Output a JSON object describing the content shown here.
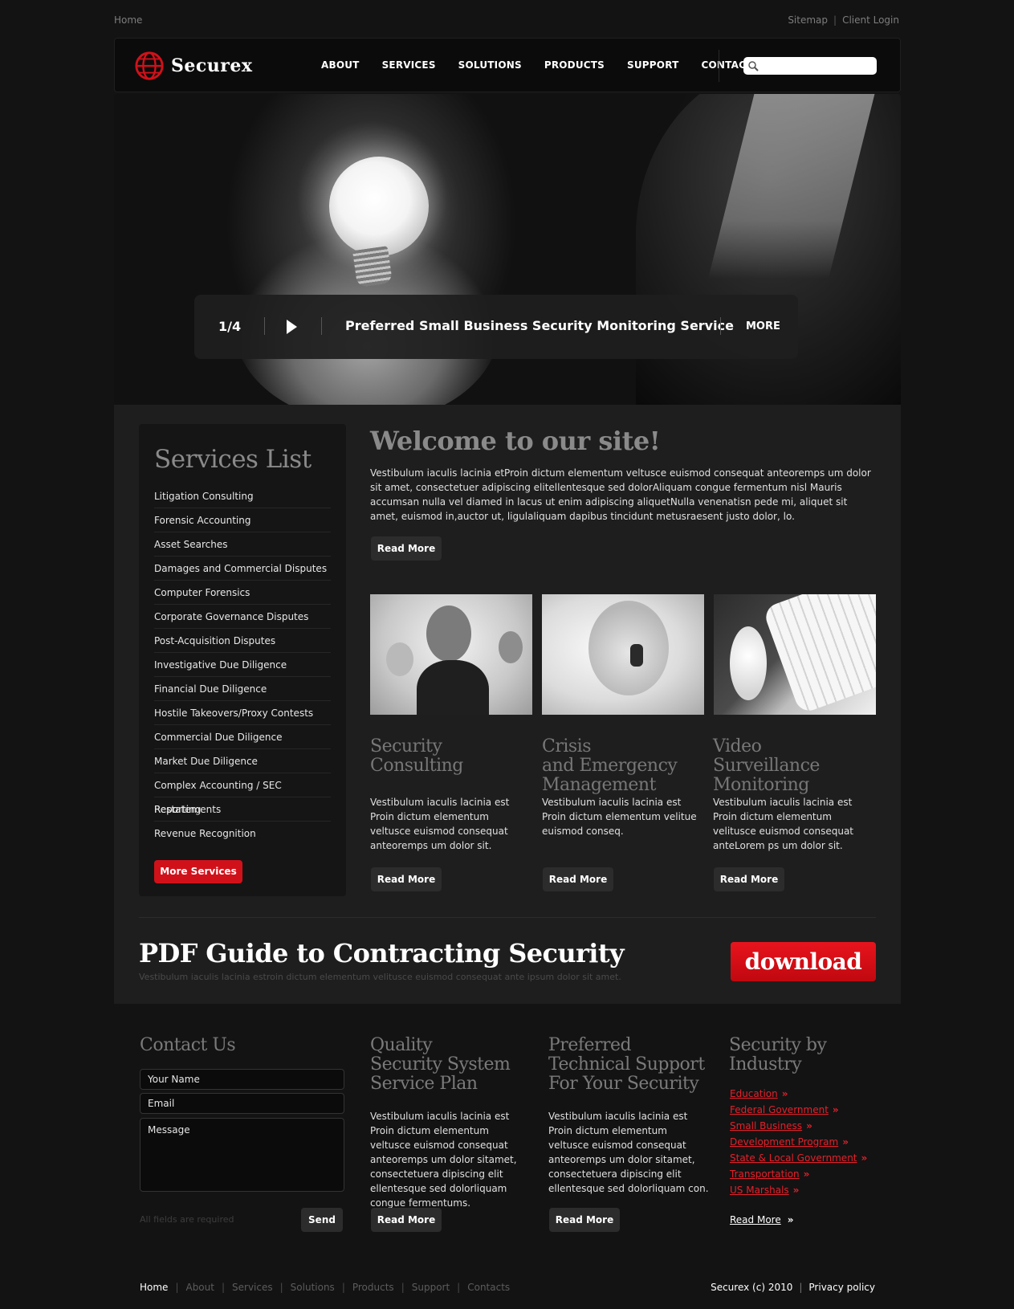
{
  "topbar": {
    "home": "Home",
    "sitemap": "Sitemap",
    "client_login": "Client Login"
  },
  "header": {
    "logo_text": "Securex",
    "nav": [
      "ABOUT",
      "SERVICES",
      "SOLUTIONS",
      "PRODUCTS",
      "SUPPORT",
      "CONTACTS"
    ],
    "search_placeholder": ""
  },
  "hero": {
    "counter": "1/4",
    "caption": "Preferred Small Business Security Monitoring Service",
    "more": "MORE"
  },
  "sidebar": {
    "title": "Services List",
    "items": [
      "Litigation Consulting",
      "Forensic Accounting",
      "Asset Searches",
      "Damages and Commercial Disputes",
      "Computer Forensics",
      "Corporate Governance Disputes",
      "Post-Acquisition Disputes",
      "Investigative Due Diligence",
      "Financial Due Diligence",
      "Hostile Takeovers/Proxy Contests",
      "Commercial Due Diligence",
      "Market Due Diligence",
      "Complex Accounting /  SEC Reporting",
      "Restatements",
      "Revenue Recognition"
    ],
    "button": "More Services"
  },
  "welcome": {
    "title": "Welcome to our site!",
    "text": "Vestibulum iaculis lacinia etProin dictum elementum veltusce euismod consequat anteoremps um dolor sit amet, consectetuer adipiscing elitellentesque sed dolorAliquam congue fermentum nisl Mauris accumsan nulla vel diamed in lacus ut enim adipiscing aliquetNulla venenatisn pede mi, aliquet sit amet, euismod in,auctor ut, ligulaliquam dapibus tincidunt metusraesent justo dolor, lo.",
    "button": "Read More"
  },
  "columns": [
    {
      "title_line1": "Security",
      "title_line2": "Consulting",
      "title_line3": "",
      "text": "Vestibulum iaculis lacinia est Proin dictum elementum veltusce euismod consequat anteoremps um dolor sit.",
      "button": "Read More"
    },
    {
      "title_line1": "Crisis",
      "title_line2": "and Emergency",
      "title_line3": "Management",
      "text": "Vestibulum iaculis lacinia est Proin dictum elementum velitue euismod conseq.",
      "button": "Read More"
    },
    {
      "title_line1": "Video Surveillance",
      "title_line2": "Monitoring",
      "title_line3": "",
      "text": "Vestibulum iaculis lacinia est Proin dictum elementum velitusce euismod consequat anteLorem ps um dolor sit.",
      "button": "Read More"
    }
  ],
  "pdf": {
    "title": "PDF Guide to Contracting Security",
    "subtitle": "Vestibulum iaculis lacinia estroin dictum elementum velitusce euismod consequat ante ipsum dolor sit amet.",
    "download": "download"
  },
  "contact": {
    "title": "Contact Us",
    "name_placeholder": "Your Name",
    "email_placeholder": "Email",
    "message_placeholder": "Message",
    "required_note": "All fields are required",
    "send": "Send"
  },
  "quality": {
    "title_line1": "Quality",
    "title_line2": "Security System",
    "title_line3": "Service Plan",
    "text": "Vestibulum iaculis lacinia est Proin dictum elementum veltusce euismod consequat anteoremps um dolor sitamet, consectetuera dipiscing elit ellentesque sed dolorliquam congue fermentums.",
    "button": "Read More"
  },
  "technical": {
    "title_line1": "Preferred",
    "title_line2": "Technical Support",
    "title_line3": "For Your Security",
    "text": "Vestibulum iaculis lacinia est Proin dictum elementum veltusce euismod consequat anteoremps um dolor sitamet, consectetuera dipiscing elit ellentesque sed dolorliquam con.",
    "button": "Read More"
  },
  "industry": {
    "title_line1": "Security by",
    "title_line2": "Industry",
    "links": [
      "Education",
      "Federal Government",
      "Small Business",
      "Development Program",
      "State & Local Government",
      "Transportation",
      "US Marshals"
    ],
    "read_more": "Read More"
  },
  "footer": {
    "nav": [
      "Home",
      "About",
      "Services",
      "Solutions",
      "Products",
      "Support",
      "Contacts"
    ],
    "copyright": "Securex (c) 2010",
    "privacy": "Privacy policy"
  },
  "colors": {
    "accent": "#d1111a",
    "background": "#131313",
    "panel": "#1e1e1e"
  }
}
